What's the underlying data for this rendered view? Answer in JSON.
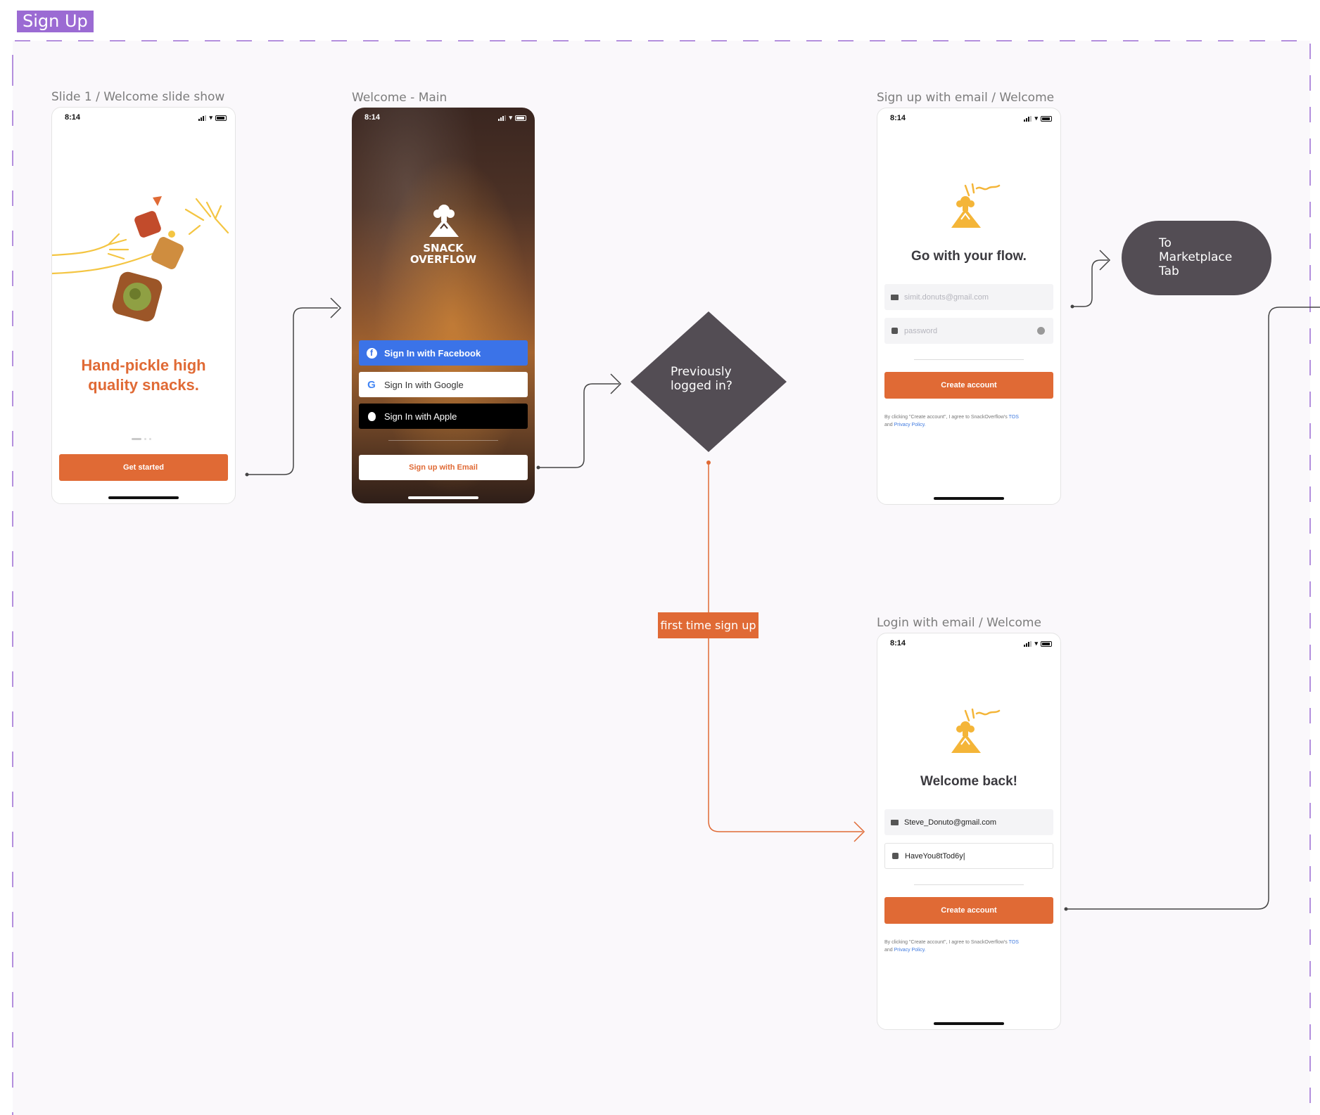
{
  "section": {
    "title": "Sign Up"
  },
  "frames": {
    "slide1": {
      "label": "Slide 1 / Welcome slide show"
    },
    "welcome_main": {
      "label": "Welcome - Main"
    },
    "signup_email": {
      "label": "Sign up with email / Welcome"
    },
    "login_email": {
      "label": "Login with email / Welcome"
    }
  },
  "status_time": "8:14",
  "slide1": {
    "headline_line1": "Hand-pickle high",
    "headline_line2": "quality snacks.",
    "cta": "Get started",
    "page_indicator": {
      "pages": 3,
      "current": 1
    }
  },
  "welcome_main": {
    "logo_line1": "SNACK",
    "logo_line2": "OVERFLOW",
    "facebook": "Sign In with Facebook",
    "google": "Sign In with Google",
    "apple": "Sign In with Apple",
    "email": "Sign up with Email"
  },
  "signup": {
    "title": "Go with your flow.",
    "email_placeholder": "simit.donuts@gmail.com",
    "password_placeholder": "password",
    "cta": "Create account",
    "legal_prefix": "By clicking \"Create account\", I agree to SnackOverflow's",
    "legal_tos": "TOS",
    "legal_and": "and",
    "legal_privacy": "Privacy Policy."
  },
  "login": {
    "title": "Welcome back!",
    "email_value": "Steve_Donuto@gmail.com",
    "password_value": "HaveYou8tTod6y|",
    "cta": "Create account",
    "legal_prefix": "By clicking \"Create account\", I agree to SnackOverflow's",
    "legal_tos": "TOS",
    "legal_and": "and",
    "legal_privacy": "Privacy Policy."
  },
  "flow": {
    "decision_line1": "Previously",
    "decision_line2": "logged in?",
    "terminal_line1": "To",
    "terminal_line2": "Marketplace",
    "terminal_line3": "Tab",
    "branch_note": "first time sign up"
  },
  "colors": {
    "accent": "#e06a35",
    "section": "#9b6bd3",
    "node": "#534d54",
    "facebook": "#3b73e8",
    "link": "#3f7ae0"
  }
}
